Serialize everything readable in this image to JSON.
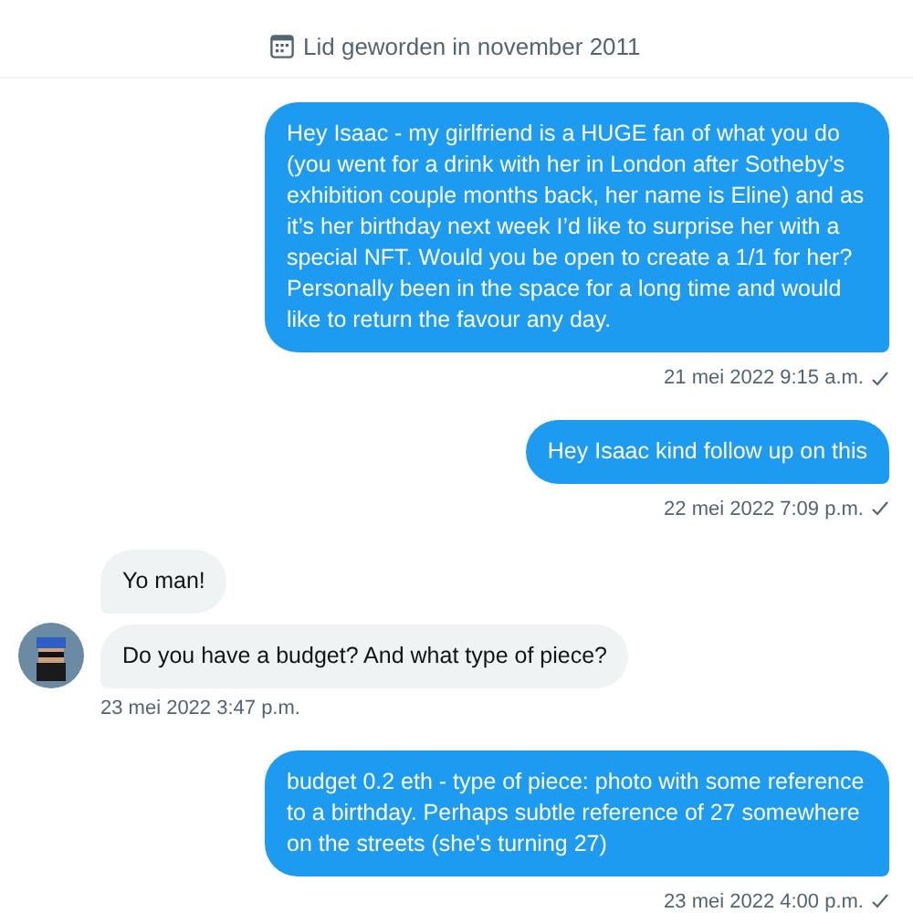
{
  "profile": {
    "joined": "Lid geworden in november 2011"
  },
  "groups": [
    {
      "kind": "sent",
      "messages": [
        "Hey Isaac - my girlfriend is a HUGE fan of what you do (you went for a drink with her in London after Sotheby’s exhibition couple months back, her name is Eline) and as it’s her birthday next week I’d like to surprise her with a special NFT. Would you be open to create a 1/1 for her? Personally been in the space for a long time and would like to return the favour any day."
      ],
      "timestamp": "21 mei 2022 9:15 a.m.",
      "seen": true
    },
    {
      "kind": "sent",
      "messages": [
        "Hey Isaac kind follow up on this"
      ],
      "timestamp": "22 mei 2022 7:09 p.m.",
      "seen": true
    },
    {
      "kind": "received",
      "messages": [
        "Yo man!",
        "Do you have a budget? And what type of piece?"
      ],
      "timestamp": "23 mei 2022 3:47 p.m.",
      "seen": false
    },
    {
      "kind": "sent",
      "messages": [
        "budget 0.2 eth - type of piece: photo with some reference to a  birthday. Perhaps subtle reference of 27 somewhere on the streets (she's turning 27)"
      ],
      "timestamp": "23 mei 2022 4:00 p.m.",
      "seen": true
    }
  ]
}
